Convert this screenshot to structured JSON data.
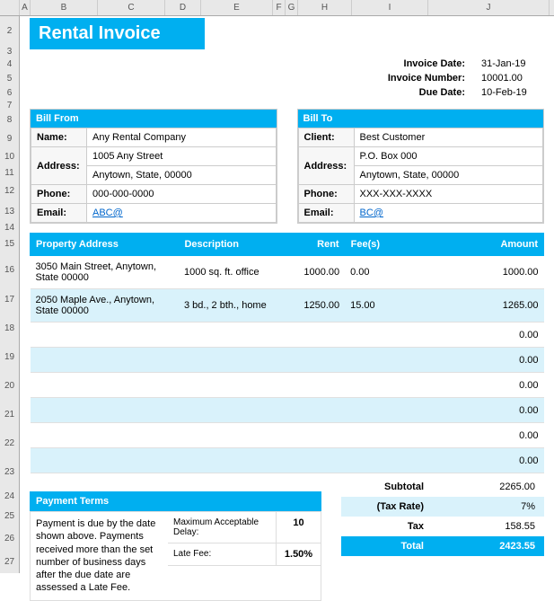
{
  "columns": [
    "A",
    "B",
    "C",
    "D",
    "E",
    "F",
    "G",
    "H",
    "I",
    "J"
  ],
  "rows": [
    "2",
    "3",
    "4",
    "5",
    "6",
    "7",
    "8",
    "9",
    "10",
    "11",
    "12",
    "13",
    "14",
    "15",
    "16",
    "17",
    "18",
    "19",
    "20",
    "21",
    "22",
    "23",
    "24",
    "25",
    "26",
    "27"
  ],
  "title": "Rental Invoice",
  "meta": {
    "date_label": "Invoice Date:",
    "date": "31-Jan-19",
    "num_label": "Invoice Number:",
    "num": "10001.00",
    "due_label": "Due Date:",
    "due": "10-Feb-19"
  },
  "from": {
    "header": "Bill From",
    "name_l": "Name:",
    "name": "Any Rental Company",
    "addr_l": "Address:",
    "addr1": "1005 Any Street",
    "addr2": "Anytown, State, 00000",
    "phone_l": "Phone:",
    "phone": "000-000-0000",
    "email_l": "Email:",
    "email": "ABC@"
  },
  "to": {
    "header": "Bill To",
    "name_l": "Client:",
    "name": "Best Customer",
    "addr_l": "Address:",
    "addr1": "P.O. Box 000",
    "addr2": "Anytown, State, 00000",
    "phone_l": "Phone:",
    "phone": "XXX-XXX-XXXX",
    "email_l": "Email:",
    "email": "BC@"
  },
  "items_header": {
    "prop": "Property Address",
    "desc": "Description",
    "rent": "Rent",
    "fee": "Fee(s)",
    "amt": "Amount"
  },
  "items": [
    {
      "prop": "3050 Main Street, Anytown, State 00000",
      "desc": "1000 sq. ft. office",
      "rent": "1000.00",
      "fee": "0.00",
      "amt": "1000.00"
    },
    {
      "prop": "2050 Maple Ave., Anytown, State 00000",
      "desc": "3 bd., 2 bth., home",
      "rent": "1250.00",
      "fee": "15.00",
      "amt": "1265.00"
    },
    {
      "prop": "",
      "desc": "",
      "rent": "",
      "fee": "",
      "amt": "0.00"
    },
    {
      "prop": "",
      "desc": "",
      "rent": "",
      "fee": "",
      "amt": "0.00"
    },
    {
      "prop": "",
      "desc": "",
      "rent": "",
      "fee": "",
      "amt": "0.00"
    },
    {
      "prop": "",
      "desc": "",
      "rent": "",
      "fee": "",
      "amt": "0.00"
    },
    {
      "prop": "",
      "desc": "",
      "rent": "",
      "fee": "",
      "amt": "0.00"
    },
    {
      "prop": "",
      "desc": "",
      "rent": "",
      "fee": "",
      "amt": "0.00"
    }
  ],
  "terms": {
    "header": "Payment Terms",
    "text": "Payment is due by the date shown above. Payments received more than the set number of business days after the due date are assessed a Late Fee.",
    "delay_l": "Maximum Acceptable Delay:",
    "delay": "10",
    "fee_l": "Late Fee:",
    "fee": "1.50%"
  },
  "totals": {
    "sub_l": "Subtotal",
    "sub": "2265.00",
    "rate_l": "(Tax Rate)",
    "rate": "7%",
    "tax_l": "Tax",
    "tax": "158.55",
    "tot_l": "Total",
    "tot": "2423.55"
  },
  "chart_data": {
    "type": "table",
    "title": "Rental Invoice",
    "columns": [
      "Property Address",
      "Description",
      "Rent",
      "Fee(s)",
      "Amount"
    ],
    "rows": [
      [
        "3050 Main Street, Anytown, State 00000",
        "1000 sq. ft. office",
        1000.0,
        0.0,
        1000.0
      ],
      [
        "2050 Maple Ave., Anytown, State 00000",
        "3 bd., 2 bth., home",
        1250.0,
        15.0,
        1265.0
      ]
    ],
    "subtotal": 2265.0,
    "tax_rate": 0.07,
    "tax": 158.55,
    "total": 2423.55
  }
}
